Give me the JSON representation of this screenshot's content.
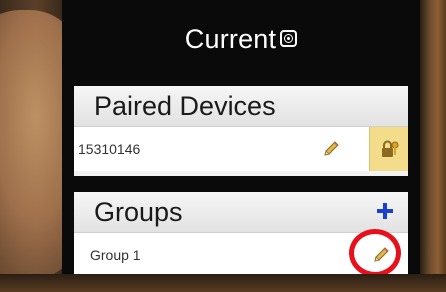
{
  "app": {
    "title": "Current",
    "logo_icon": "current-logo-icon"
  },
  "paired_devices": {
    "header": "Paired Devices",
    "devices": [
      {
        "id_text": "15310146",
        "edit_icon": "pencil-icon",
        "action_icon": "lock-key-icon"
      }
    ]
  },
  "groups": {
    "header": "Groups",
    "add_icon": "plus-icon",
    "items": [
      {
        "name": "Group 1",
        "edit_icon": "pencil-icon"
      }
    ]
  },
  "annotation": {
    "color": "#e8101a",
    "target": "group-edit-button"
  },
  "colors": {
    "accent_blue": "#1a3fd0",
    "lock_button_bg": "#f4dd8a",
    "pencil_body": "#e0b84a"
  }
}
